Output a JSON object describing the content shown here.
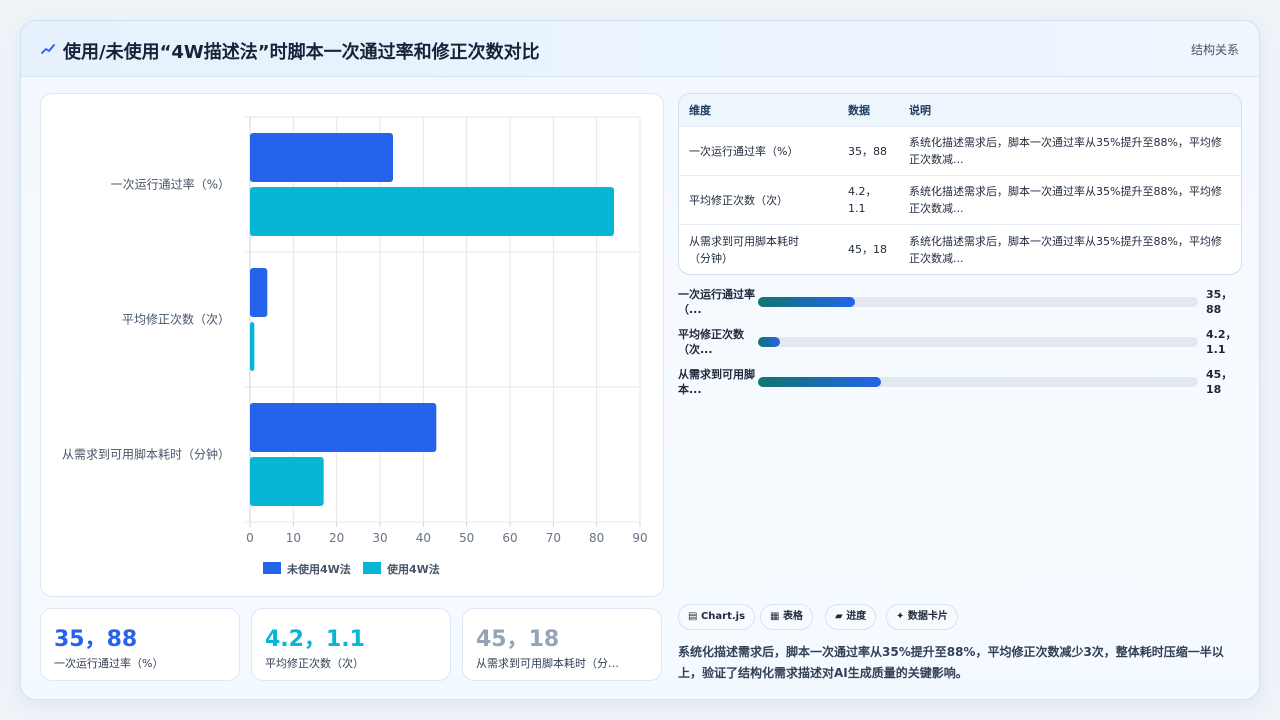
{
  "header": {
    "title": "使用/未使用“4W描述法”时脚本一次通过率和修正次数对比",
    "tag": "结构关系",
    "icon": "sparkline-icon"
  },
  "chart_data": {
    "type": "bar",
    "orientation": "horizontal",
    "categories": [
      "一次运行通过率（%）",
      "平均修正次数（次）",
      "从需求到可用脚本耗时（分钟）"
    ],
    "series": [
      {
        "name": "未使用4W法",
        "values": [
          33,
          4,
          43
        ],
        "color": "#2563eb"
      },
      {
        "name": "使用4W法",
        "values": [
          84,
          1,
          17
        ],
        "color": "#06b6d4"
      }
    ],
    "xlim": [
      0,
      90
    ],
    "xticks": [
      "0",
      "10",
      "20",
      "30",
      "40",
      "50",
      "60",
      "70",
      "80",
      "90"
    ],
    "grid": true,
    "legend": "bottom-center"
  },
  "kpis": [
    {
      "value": "35，88",
      "label": "一次运行通过率（%）",
      "color": "#2563eb"
    },
    {
      "value": "4.2，1.1",
      "label": "平均修正次数（次）",
      "color": "#06b6d4"
    },
    {
      "value": "45，18",
      "label": "从需求到可用脚本耗时（分…",
      "color": "#94a3b8"
    }
  ],
  "table": {
    "headers": [
      "维度",
      "数据",
      "说明"
    ],
    "rows": [
      {
        "dim": "一次运行通过率（%）",
        "data": "35，88",
        "desc": "系统化描述需求后，脚本一次通过率从35%提升至88%，平均修正次数减..."
      },
      {
        "dim": "平均修正次数（次）",
        "data": "4.2，1.1",
        "desc": "系统化描述需求后，脚本一次通过率从35%提升至88%，平均修正次数减..."
      },
      {
        "dim": "从需求到可用脚本耗时（分钟）",
        "data": "45，18",
        "desc": "系统化描述需求后，脚本一次通过率从35%提升至88%，平均修正次数减..."
      }
    ]
  },
  "progress": [
    {
      "label": "一次运行通过率（...",
      "value": "35，88",
      "fraction": 0.22
    },
    {
      "label": "平均修正次数（次...",
      "value": "4.2，1.1",
      "fraction": 0.05
    },
    {
      "label": "从需求到可用脚本...",
      "value": "45，18",
      "fraction": 0.28
    }
  ],
  "chips": [
    {
      "icon": "chart-icon",
      "glyph": "▤",
      "label": "Chart.js"
    },
    {
      "icon": "table-icon",
      "glyph": "▦",
      "label": "表格"
    },
    {
      "icon": "progress-icon",
      "glyph": "▰",
      "label": "进度"
    },
    {
      "icon": "card-icon",
      "glyph": "✦",
      "label": "数据卡片"
    }
  ],
  "summary": "系统化描述需求后，脚本一次通过率从35%提升至88%，平均修正次数减少3次，整体耗时压缩一半以上，验证了结构化需求描述对AI生成质量的关键影响。"
}
